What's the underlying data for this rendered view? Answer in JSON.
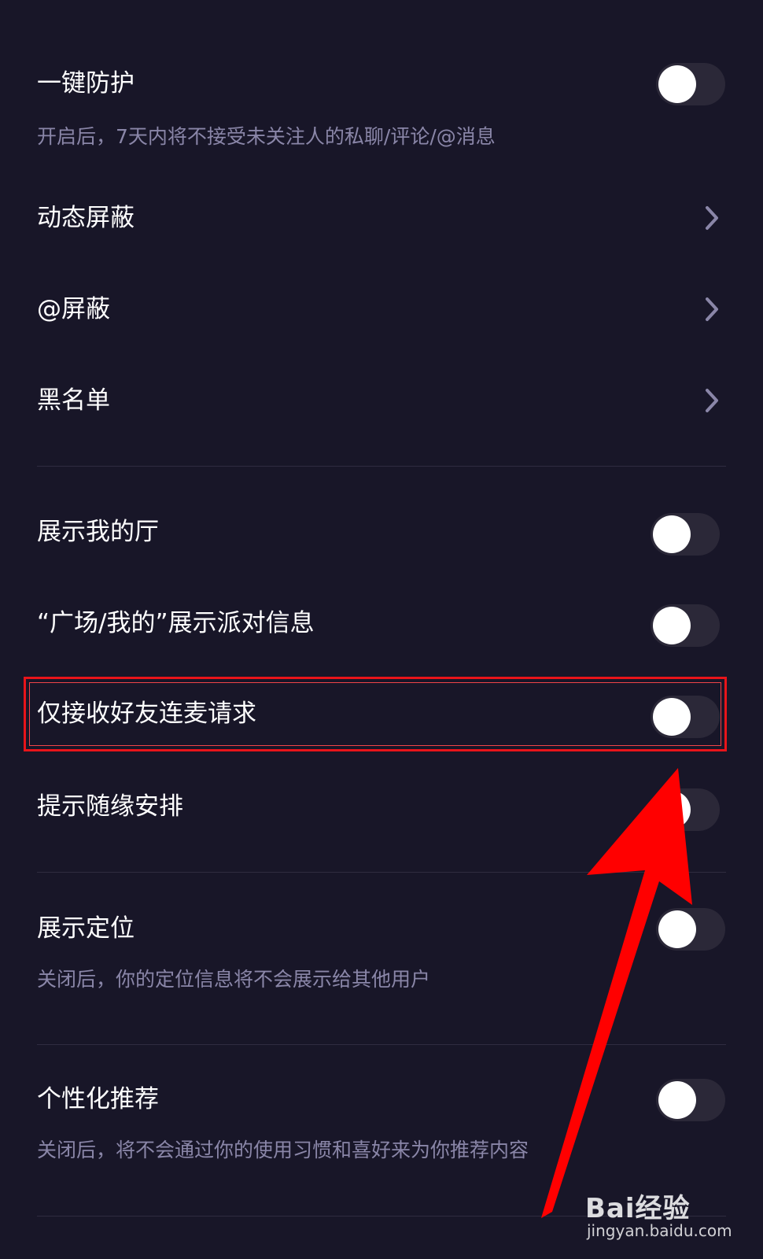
{
  "settings": {
    "one_key_protection": {
      "label": "一键防护",
      "description": "开启后，7天内将不接受未关注人的私聊/评论/@消息",
      "enabled": false
    },
    "dynamic_block": {
      "label": "动态屏蔽"
    },
    "at_block": {
      "label": "@屏蔽"
    },
    "blacklist": {
      "label": "黑名单"
    },
    "show_my_hall": {
      "label": "展示我的厅",
      "enabled": false
    },
    "show_party_info": {
      "label": "“广场/我的”展示派对信息",
      "enabled": false
    },
    "friends_only_mic": {
      "label": "仅接收好友连麦请求",
      "enabled": false
    },
    "random_arrangement": {
      "label": "提示随缘安排",
      "enabled": false
    },
    "show_location": {
      "label": "展示定位",
      "description": "关闭后，你的定位信息将不会展示给其他用户",
      "enabled": false
    },
    "personalized_recommendation": {
      "label": "个性化推荐",
      "description": "关闭后，将不会通过你的使用习惯和喜好来为你推荐内容",
      "enabled": false
    }
  },
  "watermark": {
    "logo": "Bai经验",
    "url": "jingyan.baidu.com"
  },
  "colors": {
    "background": "#181628",
    "toggle_track": "#2b2838",
    "description_text": "#8a86a8",
    "highlight": "#e8141a",
    "arrow": "#ff0000"
  },
  "icons": {
    "chevron": "chevron-right-icon",
    "annotation": "red-arrow-icon"
  }
}
